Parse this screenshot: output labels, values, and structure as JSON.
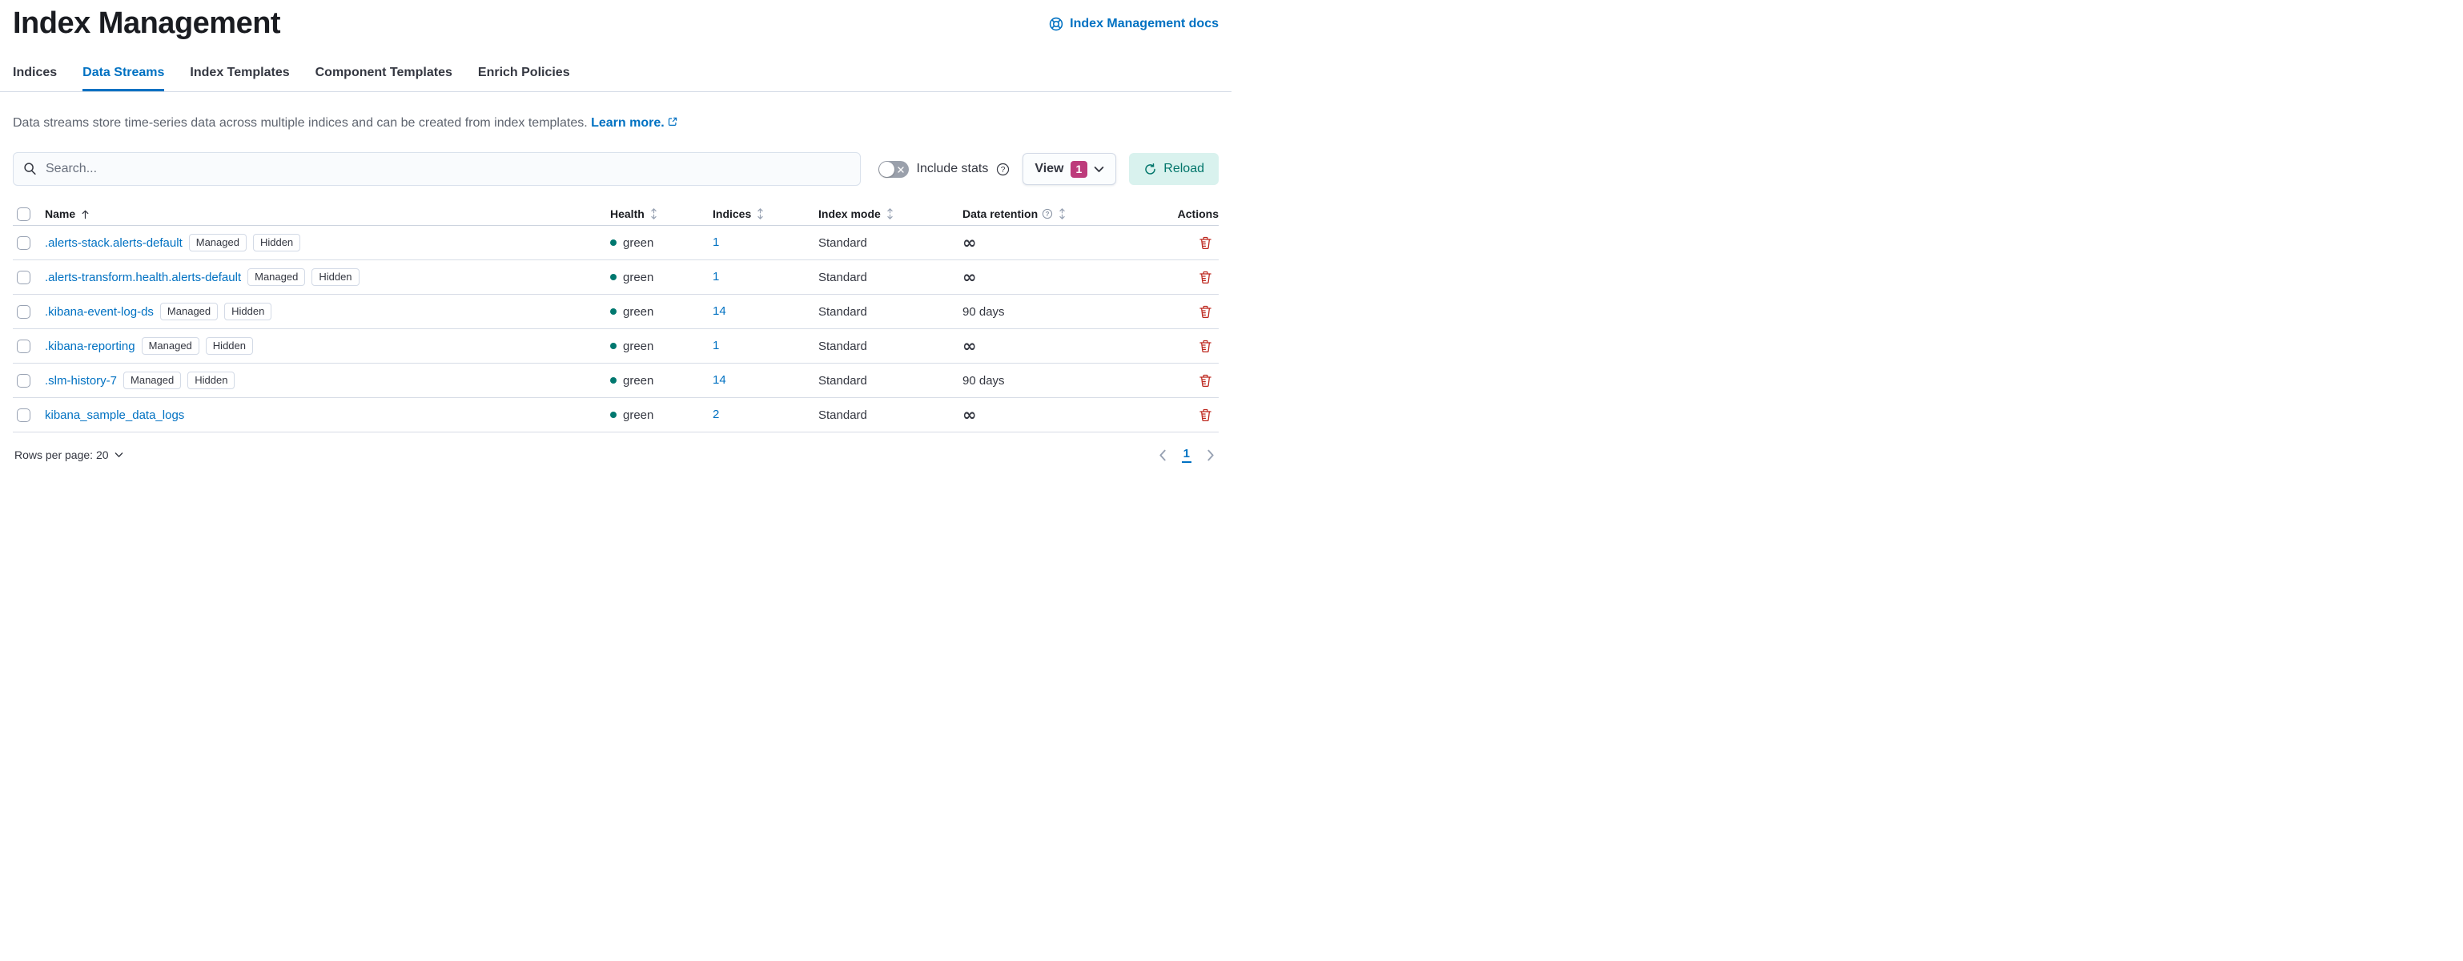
{
  "header": {
    "title": "Index Management",
    "docs_link_label": "Index Management docs"
  },
  "tabs": [
    {
      "label": "Indices"
    },
    {
      "label": "Data Streams"
    },
    {
      "label": "Index Templates"
    },
    {
      "label": "Component Templates"
    },
    {
      "label": "Enrich Policies"
    }
  ],
  "description": {
    "text": "Data streams store time-series data across multiple indices and can be created from index templates.",
    "link_label": "Learn more."
  },
  "controls": {
    "search_placeholder": "Search...",
    "include_stats_label": "Include stats",
    "view_label": "View",
    "view_count": "1",
    "reload_label": "Reload"
  },
  "table": {
    "headers": {
      "name": "Name",
      "health": "Health",
      "indices": "Indices",
      "index_mode": "Index mode",
      "data_retention": "Data retention",
      "actions": "Actions"
    },
    "rows": [
      {
        "name": ".alerts-stack.alerts-default",
        "badges": [
          "Managed",
          "Hidden"
        ],
        "health": "green",
        "indices": "1",
        "index_mode": "Standard",
        "data_retention": "∞"
      },
      {
        "name": ".alerts-transform.health.alerts-default",
        "badges": [
          "Managed",
          "Hidden"
        ],
        "health": "green",
        "indices": "1",
        "index_mode": "Standard",
        "data_retention": "∞"
      },
      {
        "name": ".kibana-event-log-ds",
        "badges": [
          "Managed",
          "Hidden"
        ],
        "health": "green",
        "indices": "14",
        "index_mode": "Standard",
        "data_retention": "90 days"
      },
      {
        "name": ".kibana-reporting",
        "badges": [
          "Managed",
          "Hidden"
        ],
        "health": "green",
        "indices": "1",
        "index_mode": "Standard",
        "data_retention": "∞"
      },
      {
        "name": ".slm-history-7",
        "badges": [
          "Managed",
          "Hidden"
        ],
        "health": "green",
        "indices": "14",
        "index_mode": "Standard",
        "data_retention": "90 days"
      },
      {
        "name": "kibana_sample_data_logs",
        "badges": [],
        "health": "green",
        "indices": "2",
        "index_mode": "Standard",
        "data_retention": "∞"
      }
    ]
  },
  "footer": {
    "rows_per_page_label": "Rows per page: 20",
    "current_page": "1"
  },
  "colors": {
    "primary_blue": "#0071c2",
    "accent_badge_pink": "#bd3b7b",
    "reload_teal_bg": "#d9f2ee",
    "reload_teal_text": "#00756a",
    "danger_red": "#bd271e",
    "health_green": "#00786f",
    "divider_gray": "#d3dae6"
  }
}
